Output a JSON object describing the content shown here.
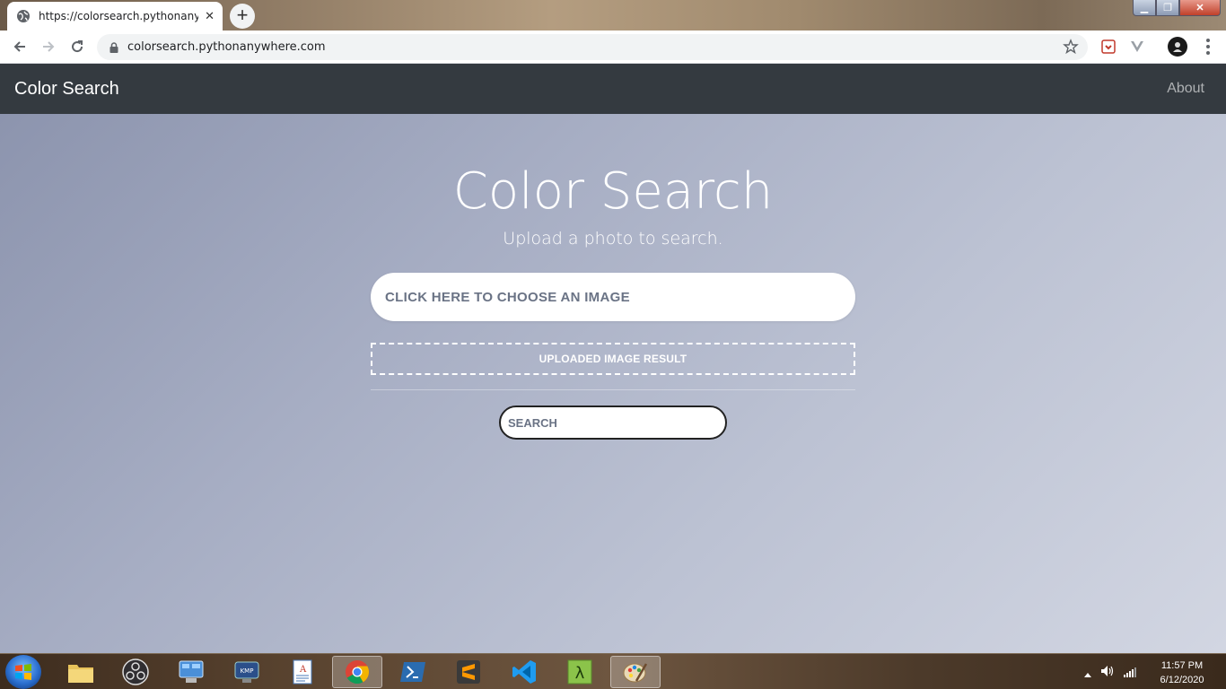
{
  "browser": {
    "tab_title": "https://colorsearch.pythonanywhe",
    "url": "colorsearch.pythonanywhere.com"
  },
  "navbar": {
    "brand": "Color Search",
    "about": "About"
  },
  "hero": {
    "title": "Color Search",
    "subtitle": "Upload a photo to search."
  },
  "upload": {
    "choose_label": "CLICK HERE TO CHOOSE AN IMAGE",
    "result_label": "UPLOADED IMAGE RESULT"
  },
  "search": {
    "label": "SEARCH"
  },
  "taskbar": {
    "apps": [
      "file-explorer",
      "obs-studio",
      "control-panel",
      "kmplayer",
      "wordpad",
      "chrome",
      "powershell",
      "sublime-text",
      "vs-code",
      "lambda-app",
      "paint"
    ],
    "active_apps": [
      "chrome",
      "paint"
    ],
    "time": "11:57 PM",
    "date": "6/12/2020"
  },
  "colors": {
    "navbar_bg": "#343a40",
    "accent_text": "#6a7385"
  }
}
